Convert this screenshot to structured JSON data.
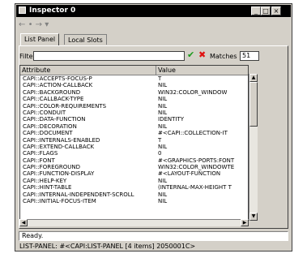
{
  "window": {
    "title": "Inspector 0"
  },
  "navbar": {
    "back": "←",
    "sep": "•",
    "forward": "→",
    "dropdown": "▾"
  },
  "tabs": [
    {
      "label": "List Panel"
    },
    {
      "label": "Local Slots"
    }
  ],
  "filter": {
    "label": "Filter:",
    "value": "",
    "matches_label": "Matches",
    "matches_value": "51"
  },
  "table": {
    "columns": [
      "Attribute",
      "Value"
    ],
    "rows": [
      [
        "CAPI::ACCEPTS-FOCUS-P",
        "T"
      ],
      [
        "CAPI::ACTION-CALLBACK",
        "NIL"
      ],
      [
        "CAPI::BACKGROUND",
        "WIN32:COLOR_WINDOW"
      ],
      [
        "CAPI::CALLBACK-TYPE",
        "NIL"
      ],
      [
        "CAPI::COLOR-REQUIREMENTS",
        "NIL"
      ],
      [
        "CAPI::CONDUIT",
        "NIL"
      ],
      [
        "CAPI::DATA-FUNCTION",
        "IDENTITY"
      ],
      [
        "CAPI::DECORATION",
        "NIL"
      ],
      [
        "CAPI::DOCUMENT",
        "#<CAPI::COLLECTION-IT"
      ],
      [
        "CAPI::INTERNALS-ENABLED",
        "T"
      ],
      [
        "CAPI::EXTEND-CALLBACK",
        "NIL"
      ],
      [
        "CAPI::FLAGS",
        "0"
      ],
      [
        "CAPI::FONT",
        "#<GRAPHICS-PORTS:FONT"
      ],
      [
        "CAPI::FOREGROUND",
        "WIN32:COLOR_WINDOWTE"
      ],
      [
        "CAPI::FUNCTION-DISPLAY",
        "#<LAYOUT-FUNCTION"
      ],
      [
        "CAPI::HELP-KEY",
        "NIL"
      ],
      [
        "CAPI::HINT-TABLE",
        "(INTERNAL-MAX-HEIGHT T"
      ],
      [
        "CAPI::INTERNAL-INDEPENDENT-SCROLL",
        "NIL"
      ],
      [
        "CAPI::INITIAL-FOCUS-ITEM",
        "NIL"
      ]
    ]
  },
  "status": {
    "message": "Ready.",
    "object": "LIST-PANEL: #<CAPI:LIST-PANEL [4 items] 2050001C>"
  }
}
